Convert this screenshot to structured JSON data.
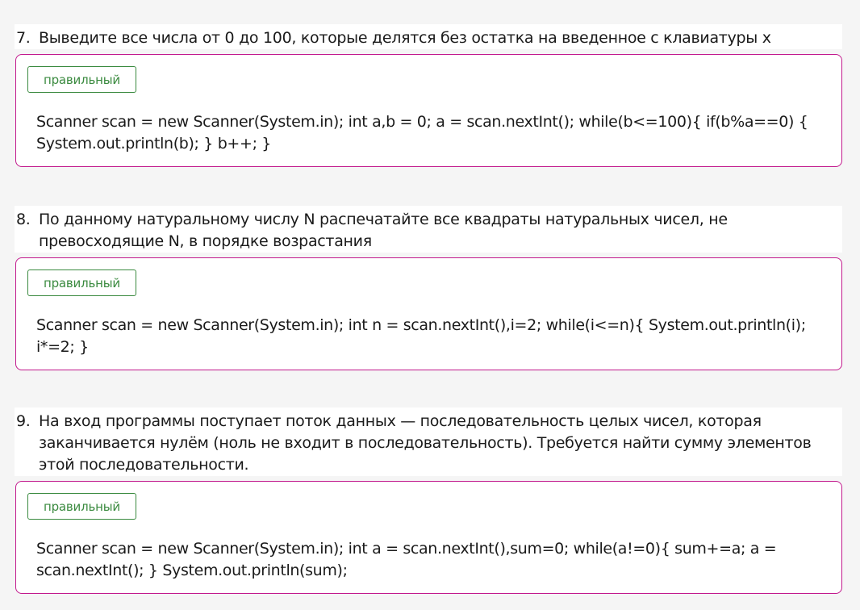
{
  "questions": [
    {
      "number": "7.",
      "text": "Выведите все числа от 0 до 100, которые делятся без остатка на введенное с клавиатуры x",
      "status": "правильный",
      "answer": "Scanner scan = new Scanner(System.in); int a,b = 0; a = scan.nextInt(); while(b<=100){ if(b%a==0) { System.out.println(b); } b++; }"
    },
    {
      "number": "8.",
      "text": "По данному натуральному числу N распечатайте все квадраты натуральных чисел, не превосходящие N, в порядке возрастания",
      "status": "правильный",
      "answer": "Scanner scan = new Scanner(System.in); int n = scan.nextInt(),i=2; while(i<=n){ System.out.println(i); i*=2; }"
    },
    {
      "number": "9.",
      "text": "На вход программы поступает поток данных — последовательность целых чисел, которая заканчивается нулём (ноль не входит в последовательность). Требуется найти сумму элементов этой последовательности.",
      "status": "правильный",
      "answer": "Scanner scan = new Scanner(System.in); int a = scan.nextInt(),sum=0; while(a!=0){ sum+=a; a = scan.nextInt(); } System.out.println(sum);"
    }
  ],
  "colors": {
    "answer_border": "#c2198d",
    "status_badge": "#3a8a3f",
    "page_background": "#f5f5f5"
  }
}
